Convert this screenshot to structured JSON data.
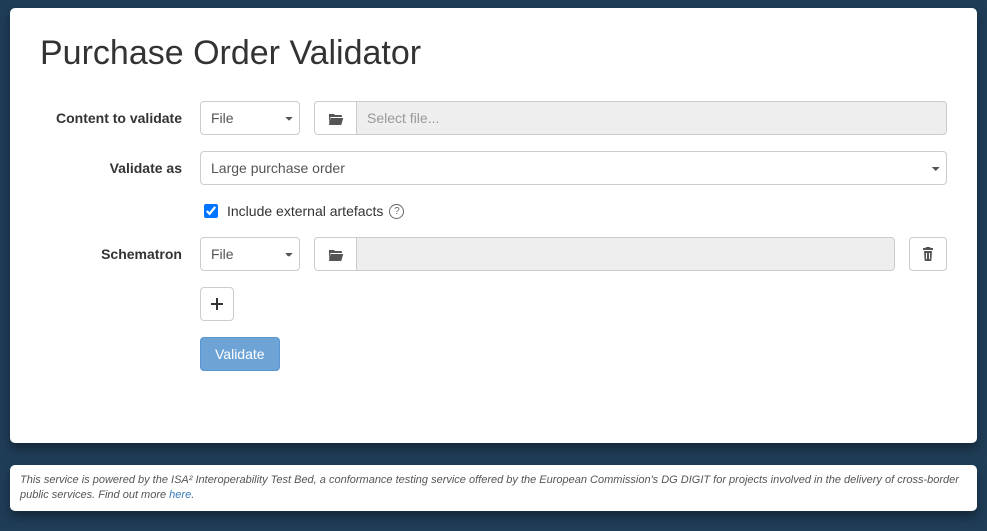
{
  "title": "Purchase Order Validator",
  "labels": {
    "content_to_validate": "Content to validate",
    "validate_as": "Validate as",
    "include_external": "Include external artefacts",
    "schematron": "Schematron"
  },
  "content": {
    "source_select": "File",
    "file_placeholder": "Select file..."
  },
  "validate_as": {
    "selected": "Large purchase order"
  },
  "include_external_checked": true,
  "schematron": {
    "source_select": "File"
  },
  "buttons": {
    "validate": "Validate"
  },
  "footer": {
    "text": "This service is powered by the ISA² Interoperability Test Bed, a conformance testing service offered by the European Commission's DG DIGIT for projects involved in the delivery of cross-border public services. Find out more ",
    "link_text": "here",
    "suffix": "."
  }
}
